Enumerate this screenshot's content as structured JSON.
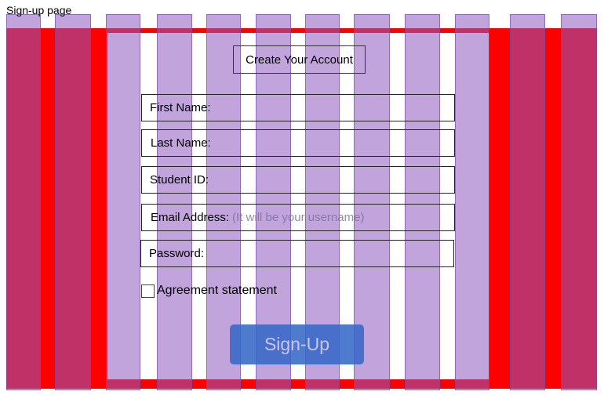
{
  "page": {
    "label": "Sign-up page"
  },
  "form": {
    "title": "Create Your Account",
    "fields": [
      {
        "label": "First Name:",
        "hint": ""
      },
      {
        "label": "Last Name:",
        "hint": ""
      },
      {
        "label": "Student ID:",
        "hint": ""
      },
      {
        "label": "Email Address:",
        "hint": "(It will be your username)"
      },
      {
        "label": "Password:",
        "hint": ""
      }
    ],
    "agreement_label": "Agreement statement",
    "agreement_checked": false,
    "submit_label": "Sign-Up"
  },
  "colors": {
    "frame": "#ff0000",
    "grid_column": "#b48ccf",
    "submit_button": "#3769c8"
  }
}
